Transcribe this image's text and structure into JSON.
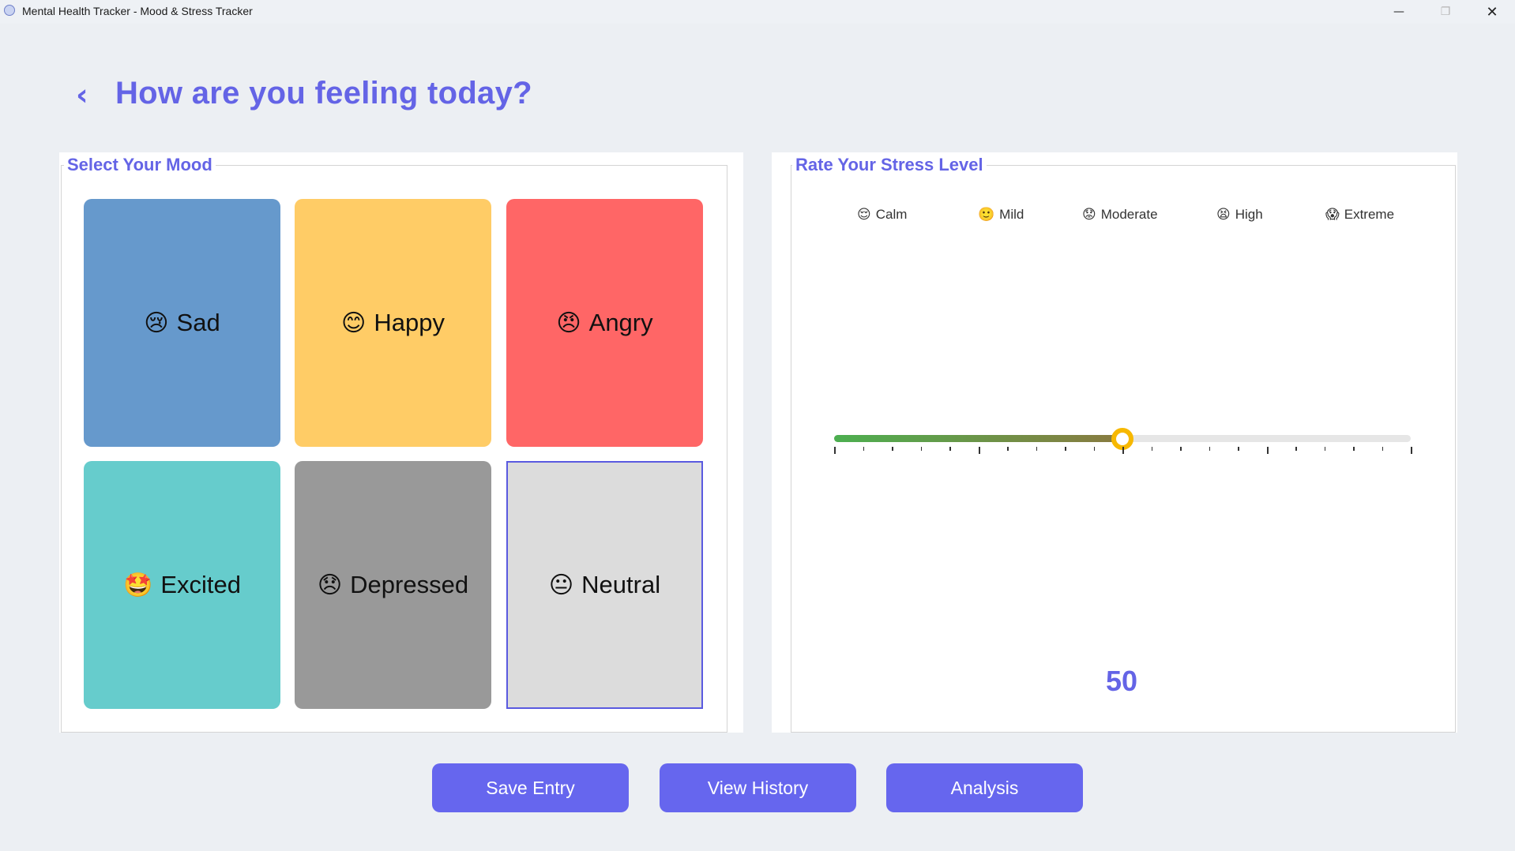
{
  "window": {
    "title": "Mental Health Tracker - Mood & Stress Tracker",
    "minimize": "—",
    "maximize": "❐",
    "close": "✕"
  },
  "header": {
    "back_icon": "‹",
    "title": "How are you feeling today?"
  },
  "mood_panel": {
    "label": "Select Your Mood",
    "moods": [
      {
        "icon": "😢",
        "label": "Sad",
        "color": "#6699cc"
      },
      {
        "icon": "😊",
        "label": "Happy",
        "color": "#ffcc66"
      },
      {
        "icon": "😠",
        "label": "Angry",
        "color": "#ff6666"
      },
      {
        "icon": "🤩",
        "label": "Excited",
        "color": "#66cccc"
      },
      {
        "icon": "😞",
        "label": "Depressed",
        "color": "#999999"
      },
      {
        "icon": "😐",
        "label": "Neutral",
        "color": "#dcdcdc",
        "selected": true
      }
    ]
  },
  "stress_panel": {
    "label": "Rate Your Stress Level",
    "scale": [
      {
        "icon": "😌",
        "label": "Calm"
      },
      {
        "icon": "🙂",
        "label": "Mild"
      },
      {
        "icon": "😟",
        "label": "Moderate"
      },
      {
        "icon": "😫",
        "label": "High"
      },
      {
        "icon": "😱",
        "label": "Extreme"
      }
    ],
    "value": "50",
    "value_fraction": 0.5
  },
  "actions": {
    "save": "Save Entry",
    "history": "View History",
    "analysis": "Analysis"
  },
  "colors": {
    "accent": "#6464e6",
    "thumb": "#f7b800"
  }
}
